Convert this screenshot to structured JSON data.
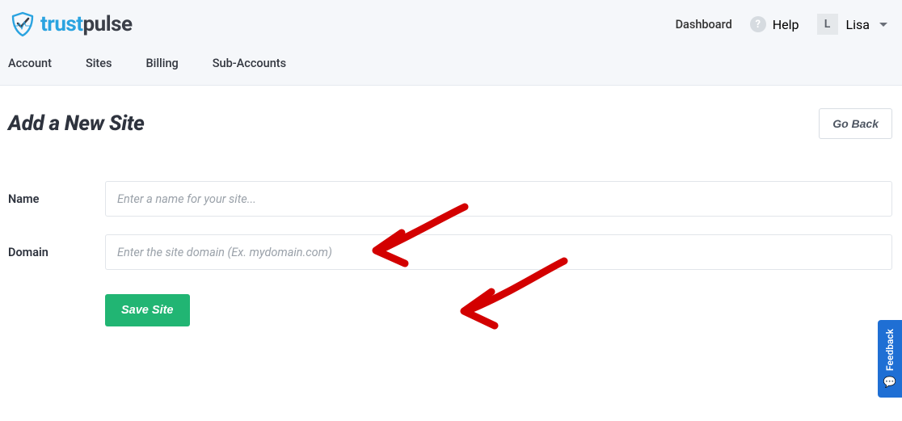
{
  "brand": {
    "trust": "trust",
    "pulse": "pulse"
  },
  "topnav": {
    "dashboard": "Dashboard",
    "help": "Help",
    "user_initial": "L",
    "user_name": "Lisa"
  },
  "subnav": {
    "items": [
      "Account",
      "Sites",
      "Billing",
      "Sub-Accounts"
    ]
  },
  "page": {
    "title": "Add a New Site",
    "go_back": "Go Back"
  },
  "form": {
    "name_label": "Name",
    "name_placeholder": "Enter a name for your site...",
    "domain_label": "Domain",
    "domain_placeholder": "Enter the site domain (Ex. mydomain.com)",
    "save_label": "Save Site"
  },
  "feedback": {
    "label": "Feedback"
  }
}
